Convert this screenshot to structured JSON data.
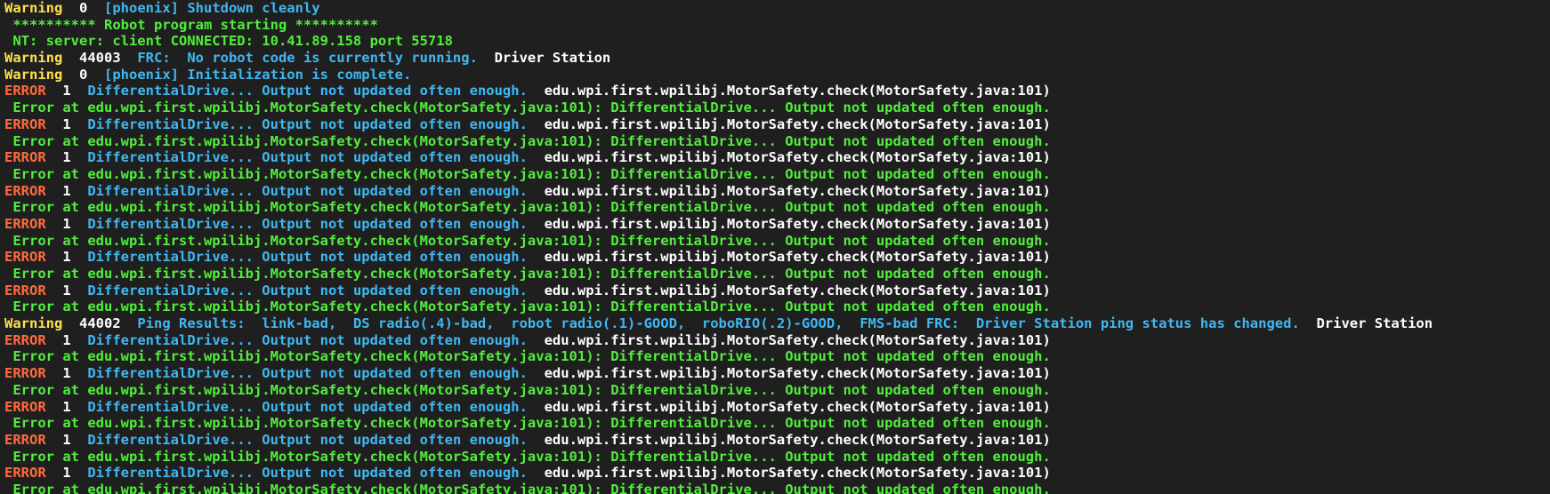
{
  "colors": {
    "background": "#1f1f1f",
    "warning": "#ffe04a",
    "error": "#ff6b3d",
    "number": "#ffffff",
    "message": "#3fb8f2",
    "source": "#ffffff",
    "plain": "#52ee3c"
  },
  "lines": [
    {
      "segments": [
        {
          "text": "Warning",
          "style": "warn"
        },
        {
          "text": "  0  ",
          "style": "num"
        },
        {
          "text": "[phoenix] Shutdown cleanly",
          "style": "blue"
        }
      ]
    },
    {
      "segments": [
        {
          "text": " ********** Robot program starting **********",
          "style": "green"
        }
      ]
    },
    {
      "segments": [
        {
          "text": " NT: server: client CONNECTED: 10.41.89.158 port 55718",
          "style": "green"
        }
      ]
    },
    {
      "segments": [
        {
          "text": "Warning",
          "style": "warn"
        },
        {
          "text": "  44003  ",
          "style": "num"
        },
        {
          "text": "FRC:  No robot code is currently running.",
          "style": "blue"
        },
        {
          "text": "  Driver Station",
          "style": "white"
        }
      ]
    },
    {
      "segments": [
        {
          "text": "Warning",
          "style": "warn"
        },
        {
          "text": "  0  ",
          "style": "num"
        },
        {
          "text": "[phoenix] Initialization is complete.",
          "style": "blue"
        }
      ]
    },
    {
      "segments": [
        {
          "text": "ERROR",
          "style": "err"
        },
        {
          "text": "  1  ",
          "style": "num"
        },
        {
          "text": "DifferentialDrive... Output not updated often enough.",
          "style": "blue"
        },
        {
          "text": "  edu.wpi.first.wpilibj.MotorSafety.check(MotorSafety.java:101)",
          "style": "white"
        }
      ]
    },
    {
      "segments": [
        {
          "text": " Error at edu.wpi.first.wpilibj.MotorSafety.check(MotorSafety.java:101): DifferentialDrive... Output not updated often enough.",
          "style": "green"
        }
      ]
    },
    {
      "segments": [
        {
          "text": "ERROR",
          "style": "err"
        },
        {
          "text": "  1  ",
          "style": "num"
        },
        {
          "text": "DifferentialDrive... Output not updated often enough.",
          "style": "blue"
        },
        {
          "text": "  edu.wpi.first.wpilibj.MotorSafety.check(MotorSafety.java:101)",
          "style": "white"
        }
      ]
    },
    {
      "segments": [
        {
          "text": " Error at edu.wpi.first.wpilibj.MotorSafety.check(MotorSafety.java:101): DifferentialDrive... Output not updated often enough.",
          "style": "green"
        }
      ]
    },
    {
      "segments": [
        {
          "text": "ERROR",
          "style": "err"
        },
        {
          "text": "  1  ",
          "style": "num"
        },
        {
          "text": "DifferentialDrive... Output not updated often enough.",
          "style": "blue"
        },
        {
          "text": "  edu.wpi.first.wpilibj.MotorSafety.check(MotorSafety.java:101)",
          "style": "white"
        }
      ]
    },
    {
      "segments": [
        {
          "text": " Error at edu.wpi.first.wpilibj.MotorSafety.check(MotorSafety.java:101): DifferentialDrive... Output not updated often enough.",
          "style": "green"
        }
      ]
    },
    {
      "segments": [
        {
          "text": "ERROR",
          "style": "err"
        },
        {
          "text": "  1  ",
          "style": "num"
        },
        {
          "text": "DifferentialDrive... Output not updated often enough.",
          "style": "blue"
        },
        {
          "text": "  edu.wpi.first.wpilibj.MotorSafety.check(MotorSafety.java:101)",
          "style": "white"
        }
      ]
    },
    {
      "segments": [
        {
          "text": " Error at edu.wpi.first.wpilibj.MotorSafety.check(MotorSafety.java:101): DifferentialDrive... Output not updated often enough.",
          "style": "green"
        }
      ]
    },
    {
      "segments": [
        {
          "text": "ERROR",
          "style": "err"
        },
        {
          "text": "  1  ",
          "style": "num"
        },
        {
          "text": "DifferentialDrive... Output not updated often enough.",
          "style": "blue"
        },
        {
          "text": "  edu.wpi.first.wpilibj.MotorSafety.check(MotorSafety.java:101)",
          "style": "white"
        }
      ]
    },
    {
      "segments": [
        {
          "text": " Error at edu.wpi.first.wpilibj.MotorSafety.check(MotorSafety.java:101): DifferentialDrive... Output not updated often enough.",
          "style": "green"
        }
      ]
    },
    {
      "segments": [
        {
          "text": "ERROR",
          "style": "err"
        },
        {
          "text": "  1  ",
          "style": "num"
        },
        {
          "text": "DifferentialDrive... Output not updated often enough.",
          "style": "blue"
        },
        {
          "text": "  edu.wpi.first.wpilibj.MotorSafety.check(MotorSafety.java:101)",
          "style": "white"
        }
      ]
    },
    {
      "segments": [
        {
          "text": " Error at edu.wpi.first.wpilibj.MotorSafety.check(MotorSafety.java:101): DifferentialDrive... Output not updated often enough.",
          "style": "green"
        }
      ]
    },
    {
      "segments": [
        {
          "text": "ERROR",
          "style": "err"
        },
        {
          "text": "  1  ",
          "style": "num"
        },
        {
          "text": "DifferentialDrive... Output not updated often enough.",
          "style": "blue"
        },
        {
          "text": "  edu.wpi.first.wpilibj.MotorSafety.check(MotorSafety.java:101)",
          "style": "white"
        }
      ]
    },
    {
      "segments": [
        {
          "text": " Error at edu.wpi.first.wpilibj.MotorSafety.check(MotorSafety.java:101): DifferentialDrive... Output not updated often enough.",
          "style": "green"
        }
      ]
    },
    {
      "segments": [
        {
          "text": "Warning",
          "style": "warn"
        },
        {
          "text": "  44002  ",
          "style": "num"
        },
        {
          "text": "Ping Results:  link-bad,  DS radio(.4)-bad,  robot radio(.1)-GOOD,  roboRIO(.2)-GOOD,  FMS-bad FRC:  Driver Station ping status has changed.",
          "style": "blue"
        },
        {
          "text": "  Driver Station",
          "style": "white"
        }
      ]
    },
    {
      "segments": [
        {
          "text": "ERROR",
          "style": "err"
        },
        {
          "text": "  1  ",
          "style": "num"
        },
        {
          "text": "DifferentialDrive... Output not updated often enough.",
          "style": "blue"
        },
        {
          "text": "  edu.wpi.first.wpilibj.MotorSafety.check(MotorSafety.java:101)",
          "style": "white"
        }
      ]
    },
    {
      "segments": [
        {
          "text": " Error at edu.wpi.first.wpilibj.MotorSafety.check(MotorSafety.java:101): DifferentialDrive... Output not updated often enough.",
          "style": "green"
        }
      ]
    },
    {
      "segments": [
        {
          "text": "ERROR",
          "style": "err"
        },
        {
          "text": "  1  ",
          "style": "num"
        },
        {
          "text": "DifferentialDrive... Output not updated often enough.",
          "style": "blue"
        },
        {
          "text": "  edu.wpi.first.wpilibj.MotorSafety.check(MotorSafety.java:101)",
          "style": "white"
        }
      ]
    },
    {
      "segments": [
        {
          "text": " Error at edu.wpi.first.wpilibj.MotorSafety.check(MotorSafety.java:101): DifferentialDrive... Output not updated often enough.",
          "style": "green"
        }
      ]
    },
    {
      "segments": [
        {
          "text": "ERROR",
          "style": "err"
        },
        {
          "text": "  1  ",
          "style": "num"
        },
        {
          "text": "DifferentialDrive... Output not updated often enough.",
          "style": "blue"
        },
        {
          "text": "  edu.wpi.first.wpilibj.MotorSafety.check(MotorSafety.java:101)",
          "style": "white"
        }
      ]
    },
    {
      "segments": [
        {
          "text": " Error at edu.wpi.first.wpilibj.MotorSafety.check(MotorSafety.java:101): DifferentialDrive... Output not updated often enough.",
          "style": "green"
        }
      ]
    },
    {
      "segments": [
        {
          "text": "ERROR",
          "style": "err"
        },
        {
          "text": "  1  ",
          "style": "num"
        },
        {
          "text": "DifferentialDrive... Output not updated often enough.",
          "style": "blue"
        },
        {
          "text": "  edu.wpi.first.wpilibj.MotorSafety.check(MotorSafety.java:101)",
          "style": "white"
        }
      ]
    },
    {
      "segments": [
        {
          "text": " Error at edu.wpi.first.wpilibj.MotorSafety.check(MotorSafety.java:101): DifferentialDrive... Output not updated often enough.",
          "style": "green"
        }
      ]
    },
    {
      "segments": [
        {
          "text": "ERROR",
          "style": "err"
        },
        {
          "text": "  1  ",
          "style": "num"
        },
        {
          "text": "DifferentialDrive... Output not updated often enough.",
          "style": "blue"
        },
        {
          "text": "  edu.wpi.first.wpilibj.MotorSafety.check(MotorSafety.java:101)",
          "style": "white"
        }
      ]
    },
    {
      "segments": [
        {
          "text": " Error at edu.wpi.first.wpilibj.MotorSafety.check(MotorSafety.java:101): DifferentialDrive... Output not updated often enough.",
          "style": "green"
        }
      ]
    }
  ]
}
